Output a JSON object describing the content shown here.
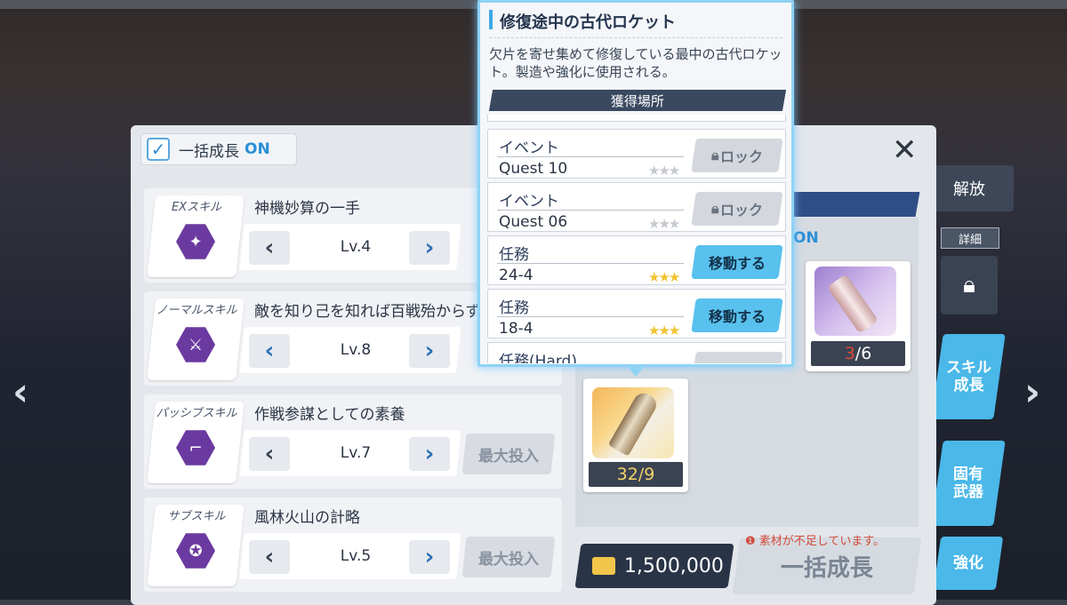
{
  "bulk_toggle": {
    "label": "一括成長",
    "state": "ON"
  },
  "skills": [
    {
      "type": "EXスキル",
      "name": "神機妙算の一手",
      "level": "Lv.4",
      "max_label": ""
    },
    {
      "type": "ノーマルスキル",
      "name": "敵を知り己を知れば百戦殆からず",
      "level": "Lv.8",
      "max_label": ""
    },
    {
      "type": "パッシブスキル",
      "name": "作戦参謀としての素養",
      "level": "Lv.7",
      "max_label": "最大投入"
    },
    {
      "type": "サブスキル",
      "name": "風林火山の計略",
      "level": "Lv.5",
      "max_label": "最大投入"
    }
  ],
  "materials": {
    "on_label": "ON",
    "rocket_count": "32/9",
    "purple_count_have": "3",
    "purple_count_need": "/6"
  },
  "credits": "1,500,000",
  "bulk_button": "一括成長",
  "warning": "❶ 素材が不足しています。",
  "side": {
    "release": "解放",
    "detail": "詳細",
    "skill_grow": "スキル\n成長",
    "unique_weapon": "固有\n武器",
    "enhance": "強化"
  },
  "popup": {
    "title": "修復途中の古代ロケット",
    "description": "欠片を寄せ集めて修復している最中の古代ロケット。製造や強化に使用される。",
    "sources_header": "獲得場所",
    "sources": [
      {
        "category": "イベント",
        "quest": "Quest 10",
        "stars": "★★★",
        "action": "ロック",
        "locked": true
      },
      {
        "category": "イベント",
        "quest": "Quest 06",
        "stars": "★★★",
        "action": "ロック",
        "locked": true
      },
      {
        "category": "任務",
        "quest": "24-4",
        "stars": "★★★",
        "action": "移動する",
        "locked": false
      },
      {
        "category": "任務",
        "quest": "18-4",
        "stars": "★★★",
        "action": "移動する",
        "locked": false
      },
      {
        "category": "任務(Hard)",
        "quest": "",
        "stars": "",
        "action": "",
        "locked": true
      }
    ]
  },
  "colors": {
    "accent": "#2c8fd8",
    "popup_glow": "#8fd3f5",
    "move_button": "#59c1ee",
    "star_active": "#f2c230",
    "star_inactive": "#c5c9cf"
  }
}
